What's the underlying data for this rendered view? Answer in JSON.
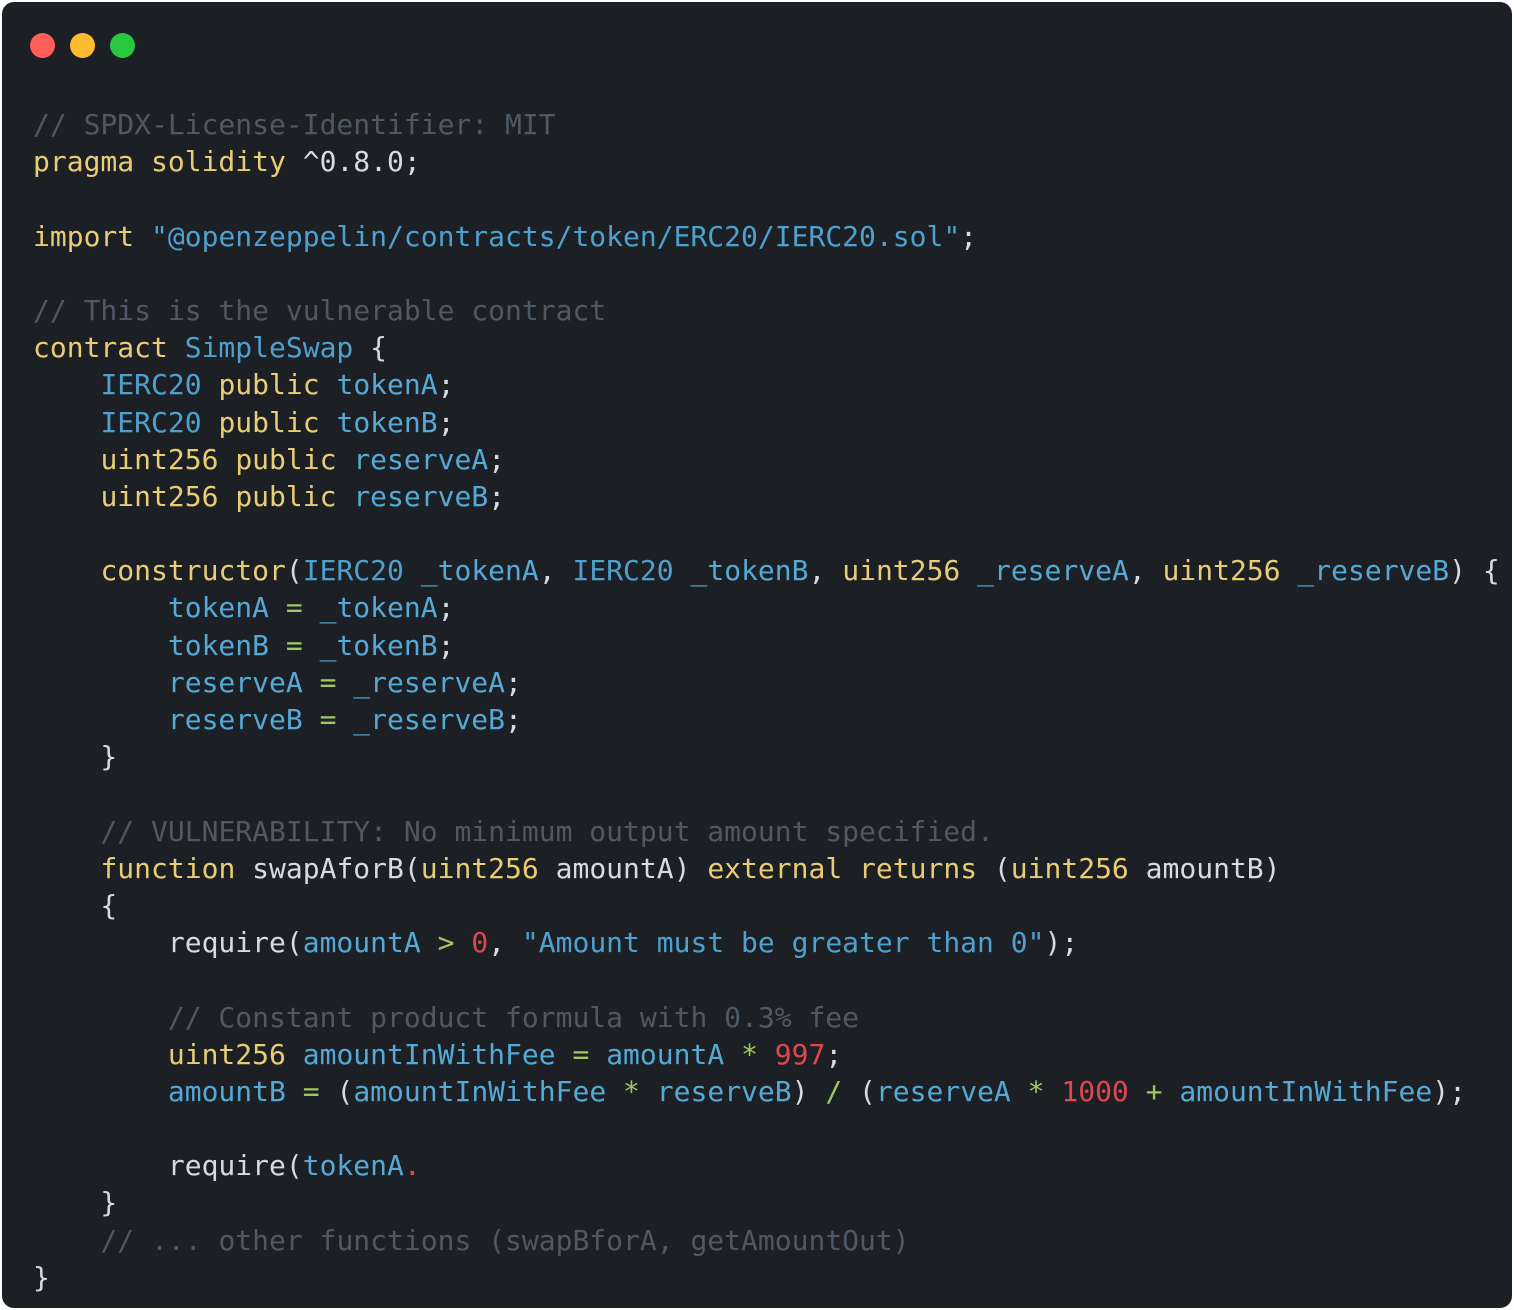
{
  "window": {
    "controls": [
      {
        "name": "close-button",
        "color": "#ff5f57"
      },
      {
        "name": "minimize-button",
        "color": "#febc2e"
      },
      {
        "name": "zoom-button",
        "color": "#28c840"
      }
    ]
  },
  "palette": {
    "comment": "#4e5964",
    "keyword": "#e9cd75",
    "type": "#4ea1cf",
    "ident": "#55a9d6",
    "string": "#4ea1cf",
    "number": "#e0464e",
    "operator": "#9ec962",
    "plain": "#d6dbe1"
  },
  "code": {
    "language": "solidity",
    "lines": [
      [
        {
          "t": "// SPDX-License-Identifier: MIT",
          "c": "comment"
        }
      ],
      [
        {
          "t": "pragma solidity",
          "c": "keyword"
        },
        {
          "t": " ^0.8.0;",
          "c": "plain"
        }
      ],
      [],
      [
        {
          "t": "import",
          "c": "keyword"
        },
        {
          "t": " ",
          "c": "plain"
        },
        {
          "t": "\"@openzeppelin/contracts/token/ERC20/IERC20.sol\"",
          "c": "string"
        },
        {
          "t": ";",
          "c": "plain"
        }
      ],
      [],
      [
        {
          "t": "// This is the vulnerable contract",
          "c": "comment"
        }
      ],
      [
        {
          "t": "contract",
          "c": "keyword"
        },
        {
          "t": " ",
          "c": "plain"
        },
        {
          "t": "SimpleSwap",
          "c": "type"
        },
        {
          "t": " {",
          "c": "plain"
        }
      ],
      [
        {
          "t": "    ",
          "c": "plain"
        },
        {
          "t": "IERC20",
          "c": "type"
        },
        {
          "t": " ",
          "c": "plain"
        },
        {
          "t": "public",
          "c": "keyword"
        },
        {
          "t": " ",
          "c": "plain"
        },
        {
          "t": "tokenA",
          "c": "ident"
        },
        {
          "t": ";",
          "c": "plain"
        }
      ],
      [
        {
          "t": "    ",
          "c": "plain"
        },
        {
          "t": "IERC20",
          "c": "type"
        },
        {
          "t": " ",
          "c": "plain"
        },
        {
          "t": "public",
          "c": "keyword"
        },
        {
          "t": " ",
          "c": "plain"
        },
        {
          "t": "tokenB",
          "c": "ident"
        },
        {
          "t": ";",
          "c": "plain"
        }
      ],
      [
        {
          "t": "    ",
          "c": "plain"
        },
        {
          "t": "uint256",
          "c": "keyword"
        },
        {
          "t": " ",
          "c": "plain"
        },
        {
          "t": "public",
          "c": "keyword"
        },
        {
          "t": " ",
          "c": "plain"
        },
        {
          "t": "reserveA",
          "c": "ident"
        },
        {
          "t": ";",
          "c": "plain"
        }
      ],
      [
        {
          "t": "    ",
          "c": "plain"
        },
        {
          "t": "uint256",
          "c": "keyword"
        },
        {
          "t": " ",
          "c": "plain"
        },
        {
          "t": "public",
          "c": "keyword"
        },
        {
          "t": " ",
          "c": "plain"
        },
        {
          "t": "reserveB",
          "c": "ident"
        },
        {
          "t": ";",
          "c": "plain"
        }
      ],
      [],
      [
        {
          "t": "    ",
          "c": "plain"
        },
        {
          "t": "constructor",
          "c": "keyword"
        },
        {
          "t": "(",
          "c": "plain"
        },
        {
          "t": "IERC20",
          "c": "type"
        },
        {
          "t": " ",
          "c": "plain"
        },
        {
          "t": "_tokenA",
          "c": "ident"
        },
        {
          "t": ", ",
          "c": "plain"
        },
        {
          "t": "IERC20",
          "c": "type"
        },
        {
          "t": " ",
          "c": "plain"
        },
        {
          "t": "_tokenB",
          "c": "ident"
        },
        {
          "t": ", ",
          "c": "plain"
        },
        {
          "t": "uint256",
          "c": "keyword"
        },
        {
          "t": " ",
          "c": "plain"
        },
        {
          "t": "_reserveA",
          "c": "ident"
        },
        {
          "t": ", ",
          "c": "plain"
        },
        {
          "t": "uint256",
          "c": "keyword"
        },
        {
          "t": " ",
          "c": "plain"
        },
        {
          "t": "_reserveB",
          "c": "ident"
        },
        {
          "t": ") {",
          "c": "plain"
        }
      ],
      [
        {
          "t": "        ",
          "c": "plain"
        },
        {
          "t": "tokenA",
          "c": "ident"
        },
        {
          "t": " ",
          "c": "plain"
        },
        {
          "t": "=",
          "c": "operator"
        },
        {
          "t": " ",
          "c": "plain"
        },
        {
          "t": "_tokenA",
          "c": "ident"
        },
        {
          "t": ";",
          "c": "plain"
        }
      ],
      [
        {
          "t": "        ",
          "c": "plain"
        },
        {
          "t": "tokenB",
          "c": "ident"
        },
        {
          "t": " ",
          "c": "plain"
        },
        {
          "t": "=",
          "c": "operator"
        },
        {
          "t": " ",
          "c": "plain"
        },
        {
          "t": "_tokenB",
          "c": "ident"
        },
        {
          "t": ";",
          "c": "plain"
        }
      ],
      [
        {
          "t": "        ",
          "c": "plain"
        },
        {
          "t": "reserveA",
          "c": "ident"
        },
        {
          "t": " ",
          "c": "plain"
        },
        {
          "t": "=",
          "c": "operator"
        },
        {
          "t": " ",
          "c": "plain"
        },
        {
          "t": "_reserveA",
          "c": "ident"
        },
        {
          "t": ";",
          "c": "plain"
        }
      ],
      [
        {
          "t": "        ",
          "c": "plain"
        },
        {
          "t": "reserveB",
          "c": "ident"
        },
        {
          "t": " ",
          "c": "plain"
        },
        {
          "t": "=",
          "c": "operator"
        },
        {
          "t": " ",
          "c": "plain"
        },
        {
          "t": "_reserveB",
          "c": "ident"
        },
        {
          "t": ";",
          "c": "plain"
        }
      ],
      [
        {
          "t": "    }",
          "c": "plain"
        }
      ],
      [],
      [
        {
          "t": "    ",
          "c": "plain"
        },
        {
          "t": "// VULNERABILITY: No minimum output amount specified.",
          "c": "comment"
        }
      ],
      [
        {
          "t": "    ",
          "c": "plain"
        },
        {
          "t": "function",
          "c": "keyword"
        },
        {
          "t": " swapAforB(",
          "c": "plain"
        },
        {
          "t": "uint256",
          "c": "keyword"
        },
        {
          "t": " amountA) ",
          "c": "plain"
        },
        {
          "t": "external",
          "c": "keyword"
        },
        {
          "t": " ",
          "c": "plain"
        },
        {
          "t": "returns",
          "c": "keyword"
        },
        {
          "t": " (",
          "c": "plain"
        },
        {
          "t": "uint256",
          "c": "keyword"
        },
        {
          "t": " amountB)",
          "c": "plain"
        }
      ],
      [
        {
          "t": "    {",
          "c": "plain"
        }
      ],
      [
        {
          "t": "        require(",
          "c": "plain"
        },
        {
          "t": "amountA",
          "c": "ident"
        },
        {
          "t": " ",
          "c": "plain"
        },
        {
          "t": ">",
          "c": "operator"
        },
        {
          "t": " ",
          "c": "plain"
        },
        {
          "t": "0",
          "c": "number"
        },
        {
          "t": ", ",
          "c": "plain"
        },
        {
          "t": "\"Amount must be greater than 0\"",
          "c": "string"
        },
        {
          "t": ");",
          "c": "plain"
        }
      ],
      [],
      [
        {
          "t": "        ",
          "c": "plain"
        },
        {
          "t": "// Constant product formula with 0.3% fee",
          "c": "comment"
        }
      ],
      [
        {
          "t": "        ",
          "c": "plain"
        },
        {
          "t": "uint256",
          "c": "keyword"
        },
        {
          "t": " ",
          "c": "plain"
        },
        {
          "t": "amountInWithFee",
          "c": "ident"
        },
        {
          "t": " ",
          "c": "plain"
        },
        {
          "t": "=",
          "c": "operator"
        },
        {
          "t": " ",
          "c": "plain"
        },
        {
          "t": "amountA",
          "c": "ident"
        },
        {
          "t": " ",
          "c": "plain"
        },
        {
          "t": "*",
          "c": "operator"
        },
        {
          "t": " ",
          "c": "plain"
        },
        {
          "t": "997",
          "c": "number"
        },
        {
          "t": ";",
          "c": "plain"
        }
      ],
      [
        {
          "t": "        ",
          "c": "plain"
        },
        {
          "t": "amountB",
          "c": "ident"
        },
        {
          "t": " ",
          "c": "plain"
        },
        {
          "t": "=",
          "c": "operator"
        },
        {
          "t": " (",
          "c": "plain"
        },
        {
          "t": "amountInWithFee",
          "c": "ident"
        },
        {
          "t": " ",
          "c": "plain"
        },
        {
          "t": "*",
          "c": "operator"
        },
        {
          "t": " ",
          "c": "plain"
        },
        {
          "t": "reserveB",
          "c": "ident"
        },
        {
          "t": ") ",
          "c": "plain"
        },
        {
          "t": "/",
          "c": "operator"
        },
        {
          "t": " (",
          "c": "plain"
        },
        {
          "t": "reserveA",
          "c": "ident"
        },
        {
          "t": " ",
          "c": "plain"
        },
        {
          "t": "*",
          "c": "operator"
        },
        {
          "t": " ",
          "c": "plain"
        },
        {
          "t": "1000",
          "c": "number"
        },
        {
          "t": " ",
          "c": "plain"
        },
        {
          "t": "+",
          "c": "operator"
        },
        {
          "t": " ",
          "c": "plain"
        },
        {
          "t": "amountInWithFee",
          "c": "ident"
        },
        {
          "t": ");",
          "c": "plain"
        }
      ],
      [],
      [
        {
          "t": "        require(",
          "c": "plain"
        },
        {
          "t": "tokenA",
          "c": "ident"
        },
        {
          "t": ".",
          "c": "number"
        }
      ],
      [
        {
          "t": "    }",
          "c": "plain"
        }
      ],
      [
        {
          "t": "    ",
          "c": "plain"
        },
        {
          "t": "// ... other functions (swapBforA, getAmountOut)",
          "c": "comment"
        }
      ],
      [
        {
          "t": "}",
          "c": "plain"
        }
      ]
    ]
  }
}
